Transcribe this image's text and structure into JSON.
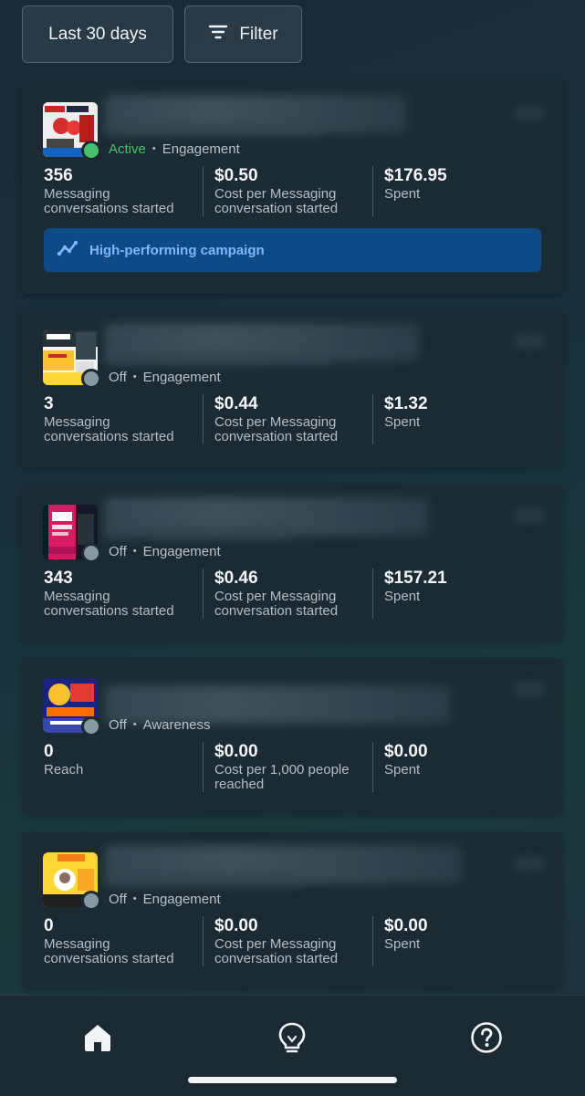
{
  "toolbar": {
    "date_range": "Last 30 days",
    "filter_label": "Filter"
  },
  "campaigns": [
    {
      "status": "Active",
      "objective": "Engagement",
      "metrics": [
        {
          "value": "356",
          "label": "Messaging conversations started"
        },
        {
          "value": "$0.50",
          "label": "Cost per Messaging conversation started"
        },
        {
          "value": "$176.95",
          "label": "Spent"
        }
      ],
      "banner": "High-performing campaign"
    },
    {
      "status": "Off",
      "objective": "Engagement",
      "metrics": [
        {
          "value": "3",
          "label": "Messaging conversations started"
        },
        {
          "value": "$0.44",
          "label": "Cost per Messaging conversation started"
        },
        {
          "value": "$1.32",
          "label": "Spent"
        }
      ]
    },
    {
      "status": "Off",
      "objective": "Engagement",
      "metrics": [
        {
          "value": "343",
          "label": "Messaging conversations started"
        },
        {
          "value": "$0.46",
          "label": "Cost per Messaging conversation started"
        },
        {
          "value": "$157.21",
          "label": "Spent"
        }
      ]
    },
    {
      "status": "Off",
      "objective": "Awareness",
      "metrics": [
        {
          "value": "0",
          "label": "Reach"
        },
        {
          "value": "$0.00",
          "label": "Cost per 1,000 people reached"
        },
        {
          "value": "$0.00",
          "label": "Spent"
        }
      ]
    },
    {
      "status": "Off",
      "objective": "Engagement",
      "metrics": [
        {
          "value": "0",
          "label": "Messaging conversations started"
        },
        {
          "value": "$0.00",
          "label": "Cost per Messaging conversation started"
        },
        {
          "value": "$0.00",
          "label": "Spent"
        }
      ]
    }
  ],
  "colors": {
    "active": "#49c06b",
    "off": "#8a98a3",
    "banner_bg": "#0e4a86",
    "banner_text": "#7fb6ff"
  },
  "nav": [
    {
      "icon": "home-icon",
      "selected": true
    },
    {
      "icon": "lightbulb-icon",
      "selected": false
    },
    {
      "icon": "help-icon",
      "selected": false
    }
  ]
}
